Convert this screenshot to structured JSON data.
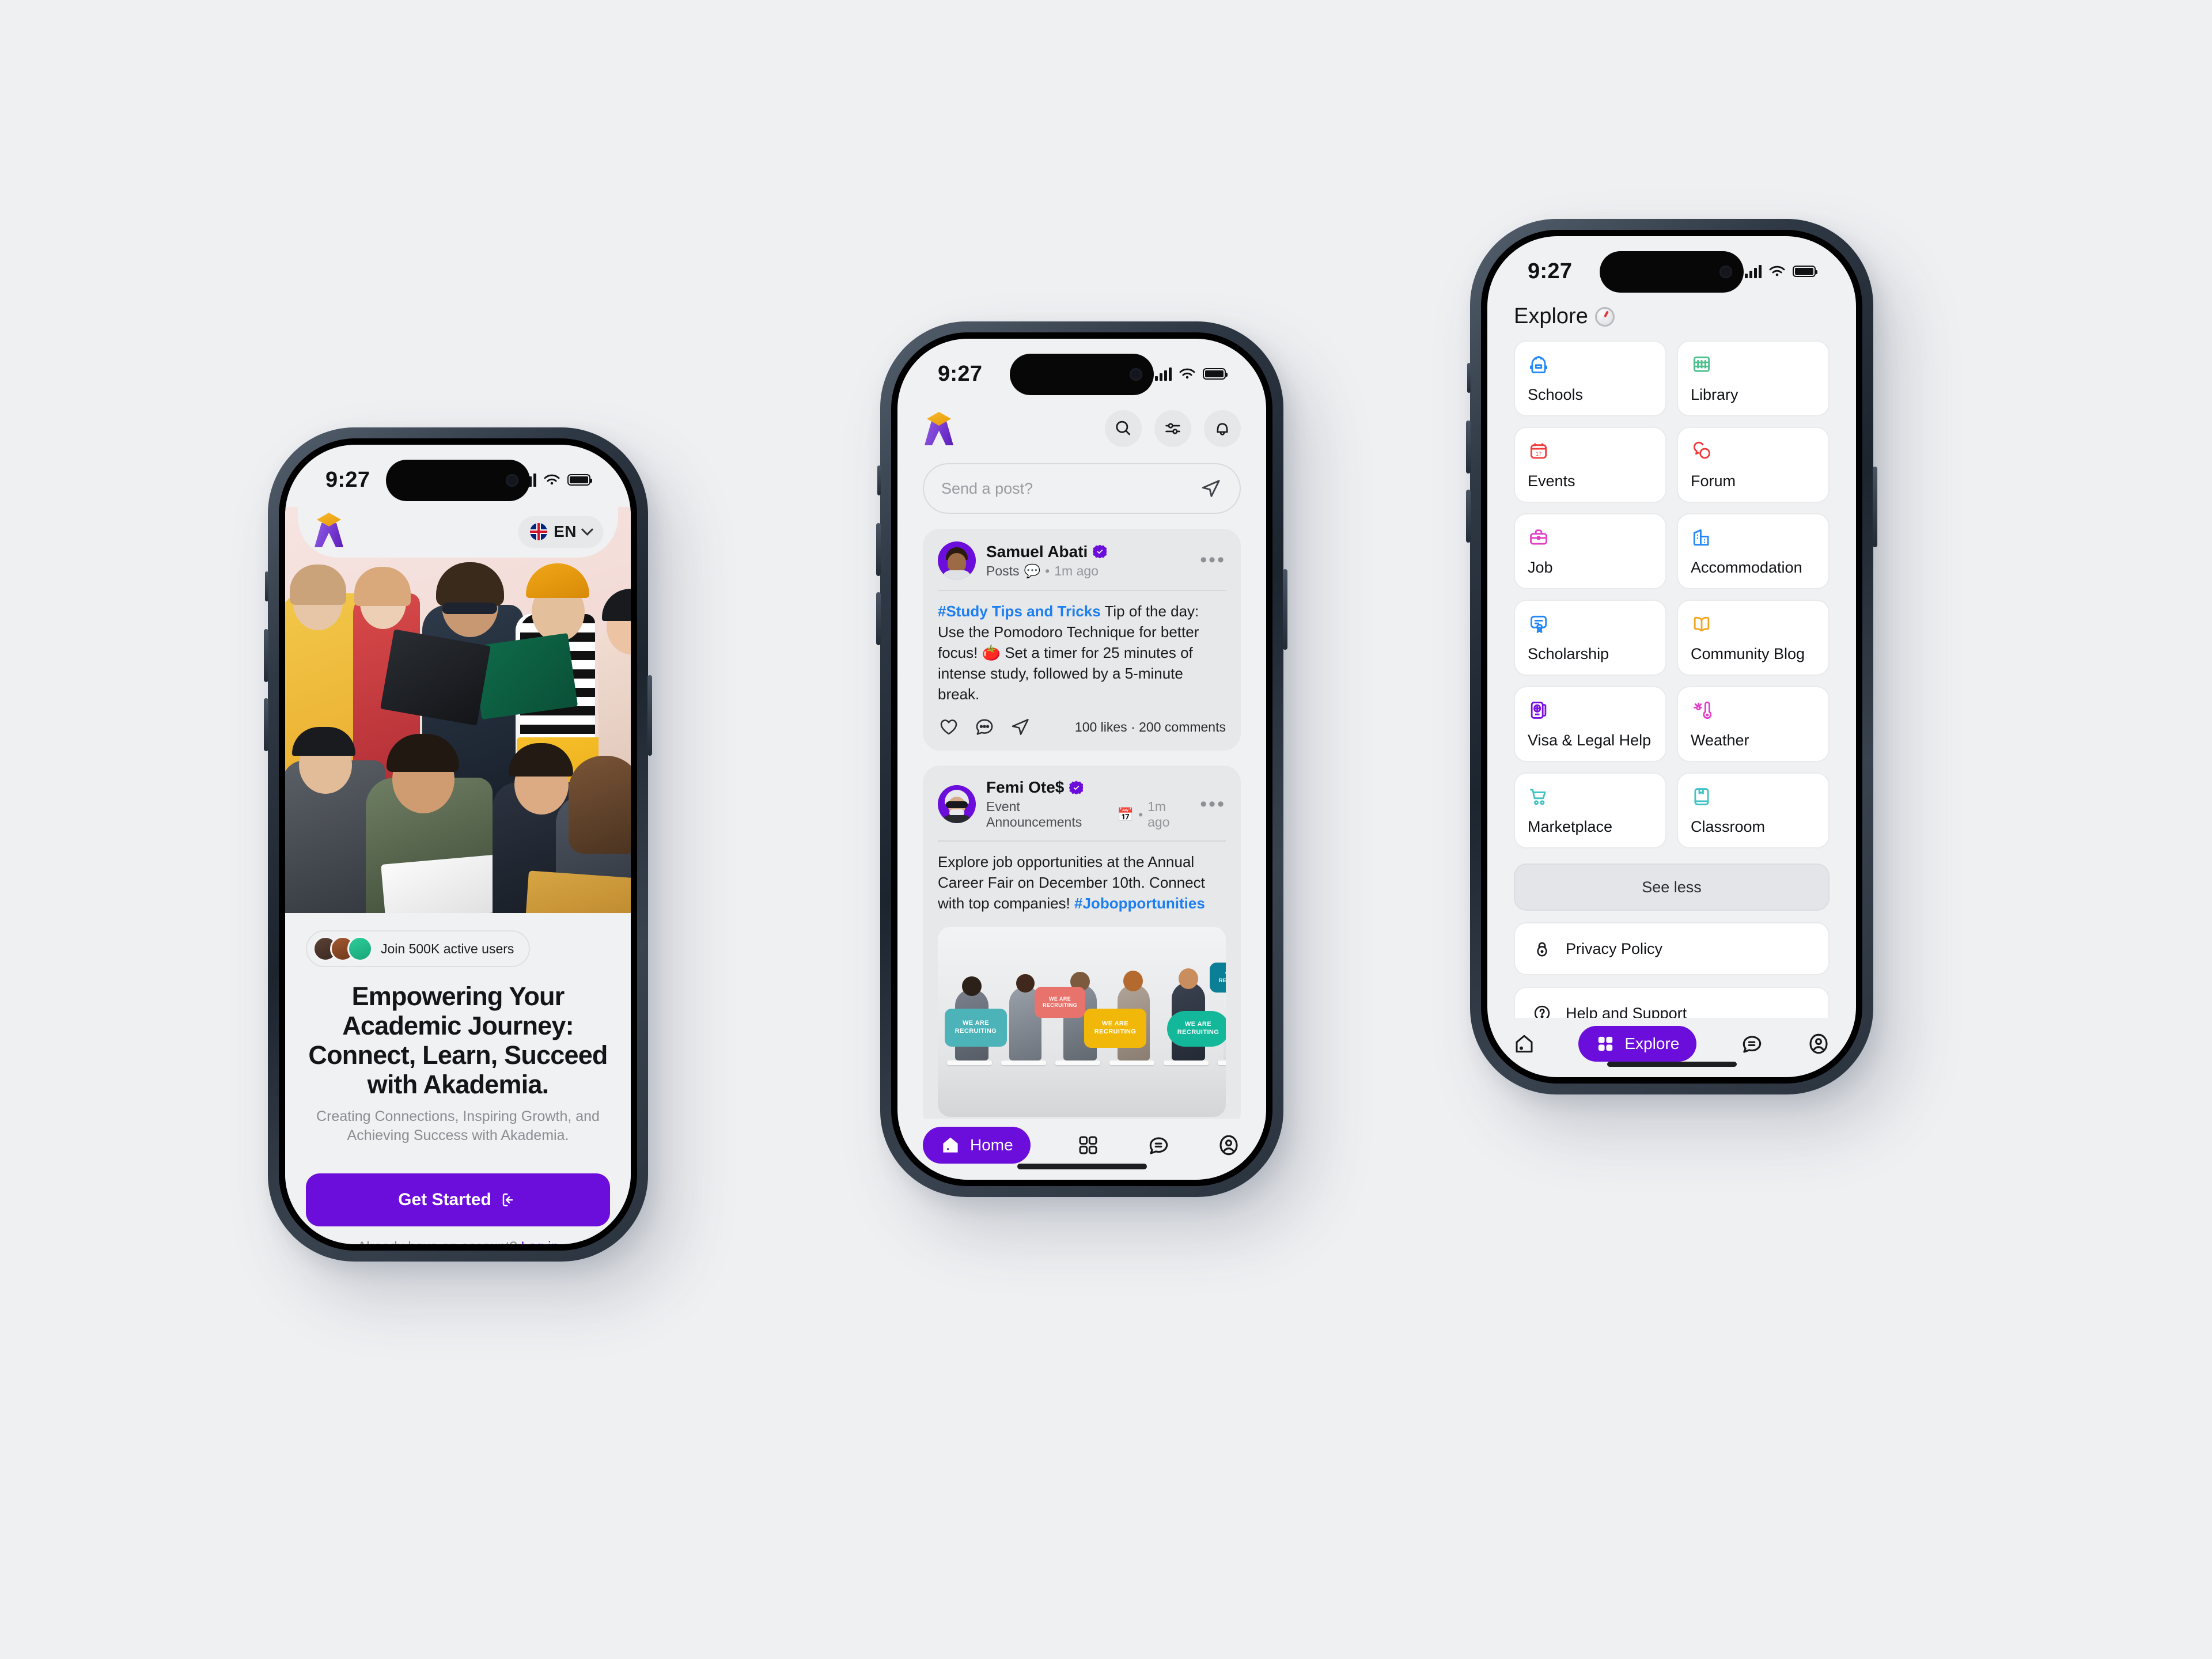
{
  "brand": {
    "name": "Akademia",
    "accent": "#6b0ddb",
    "logo": "akademia-graduation-cap-logo"
  },
  "background": "#eff0f2",
  "phone1": {
    "status": {
      "time": "9:27",
      "signal": "cellular-signal-icon",
      "wifi": "wifi-icon",
      "battery": "battery-icon"
    },
    "header": {
      "logo": "akademia-logo",
      "language": {
        "flag": "uk-flag-icon",
        "code": "EN",
        "chevron": "chevron-down-icon"
      }
    },
    "hero_image": "students-studying-together-photo",
    "social_proof": {
      "text": "Join 500K active users",
      "avatars": [
        "user-avatar-1",
        "user-avatar-2",
        "user-avatar-3"
      ]
    },
    "headline": "Empowering Your Academic Journey: Connect, Learn, Succeed with Akademia.",
    "subheadline": "Creating Connections, Inspiring Growth, and Achieving Success with Akademia.",
    "cta": {
      "label": "Get Started",
      "icon": "arrow-enter-icon"
    },
    "login": {
      "prompt": "Already have an account?",
      "link": "Log in"
    }
  },
  "phone2": {
    "status": {
      "time": "9:27"
    },
    "header": {
      "logo": "akademia-logo",
      "actions": [
        "search-icon",
        "filter-icon",
        "bell-icon"
      ]
    },
    "composer": {
      "placeholder": "Send a post?",
      "send_icon": "send-icon"
    },
    "posts": [
      {
        "author": "Samuel Abati",
        "verified": true,
        "category": "Posts",
        "category_icon": "speech-bubble-emoji",
        "time": "1m ago",
        "hashtag": "#Study Tips and Tricks",
        "body": " Tip of the day: Use the Pomodoro Technique for better focus! 🍅 Set a timer for 25 minutes of intense study, followed by a 5-minute break.",
        "likes": "100 likes",
        "comments": "200 comments",
        "separator": "·",
        "actions": [
          "like-heart-icon",
          "comment-icon",
          "share-icon"
        ]
      },
      {
        "author": "Femi Ote$",
        "verified": true,
        "category": "Event Announcements",
        "category_icon": "calendar-emoji",
        "time": "1m ago",
        "body": "Explore job opportunities at the Annual Career Fair on December 10th. Connect with top companies! ",
        "hashtag": "#Jobopportunities",
        "image": "we-are-recruiting-career-fair-photo",
        "image_text": "WE ARE RECRUITING"
      }
    ],
    "tabs": [
      {
        "label": "Home",
        "icon": "home-icon",
        "active": true
      },
      {
        "label": "Explore",
        "icon": "grid-icon",
        "active": false
      },
      {
        "label": "Messages",
        "icon": "chat-icon",
        "active": false
      },
      {
        "label": "Profile",
        "icon": "user-icon",
        "active": false
      }
    ]
  },
  "phone3": {
    "status": {
      "time": "9:27"
    },
    "title": "Explore",
    "title_icon": "compass-emoji",
    "grid": [
      {
        "label": "Schools",
        "icon": "backpack-icon",
        "color": "#2287f5"
      },
      {
        "label": "Library",
        "icon": "bookshelf-icon",
        "color": "#4cbf8b"
      },
      {
        "label": "Events",
        "icon": "calendar-icon",
        "color": "#ef3b3b"
      },
      {
        "label": "Forum",
        "icon": "chat-bubbles-icon",
        "color": "#ef3b3b"
      },
      {
        "label": "Job",
        "icon": "briefcase-icon",
        "color": "#e040c8"
      },
      {
        "label": "Accommodation",
        "icon": "building-icon",
        "color": "#2287f5"
      },
      {
        "label": "Scholarship",
        "icon": "certificate-icon",
        "color": "#2287f5"
      },
      {
        "label": "Community Blog",
        "icon": "open-book-icon",
        "color": "#f1a41e"
      },
      {
        "label": "Visa & Legal Help",
        "icon": "passport-icon",
        "color": "#7a10e0"
      },
      {
        "label": "Weather",
        "icon": "thermometer-icon",
        "color": "#e040c8"
      },
      {
        "label": "Marketplace",
        "icon": "shopping-cart-icon",
        "color": "#3fc2c4"
      },
      {
        "label": "Classroom",
        "icon": "notebook-icon",
        "color": "#3fc2c4"
      }
    ],
    "see_less": "See less",
    "links": [
      {
        "label": "Privacy Policy",
        "icon": "lock-icon"
      },
      {
        "label": "Help and Support",
        "icon": "question-circle-icon"
      }
    ],
    "tabs": [
      {
        "label": "Home",
        "icon": "home-icon",
        "active": false
      },
      {
        "label": "Explore",
        "icon": "grid-icon",
        "active": true
      },
      {
        "label": "Messages",
        "icon": "chat-icon",
        "active": false
      },
      {
        "label": "Profile",
        "icon": "user-icon",
        "active": false
      }
    ]
  }
}
